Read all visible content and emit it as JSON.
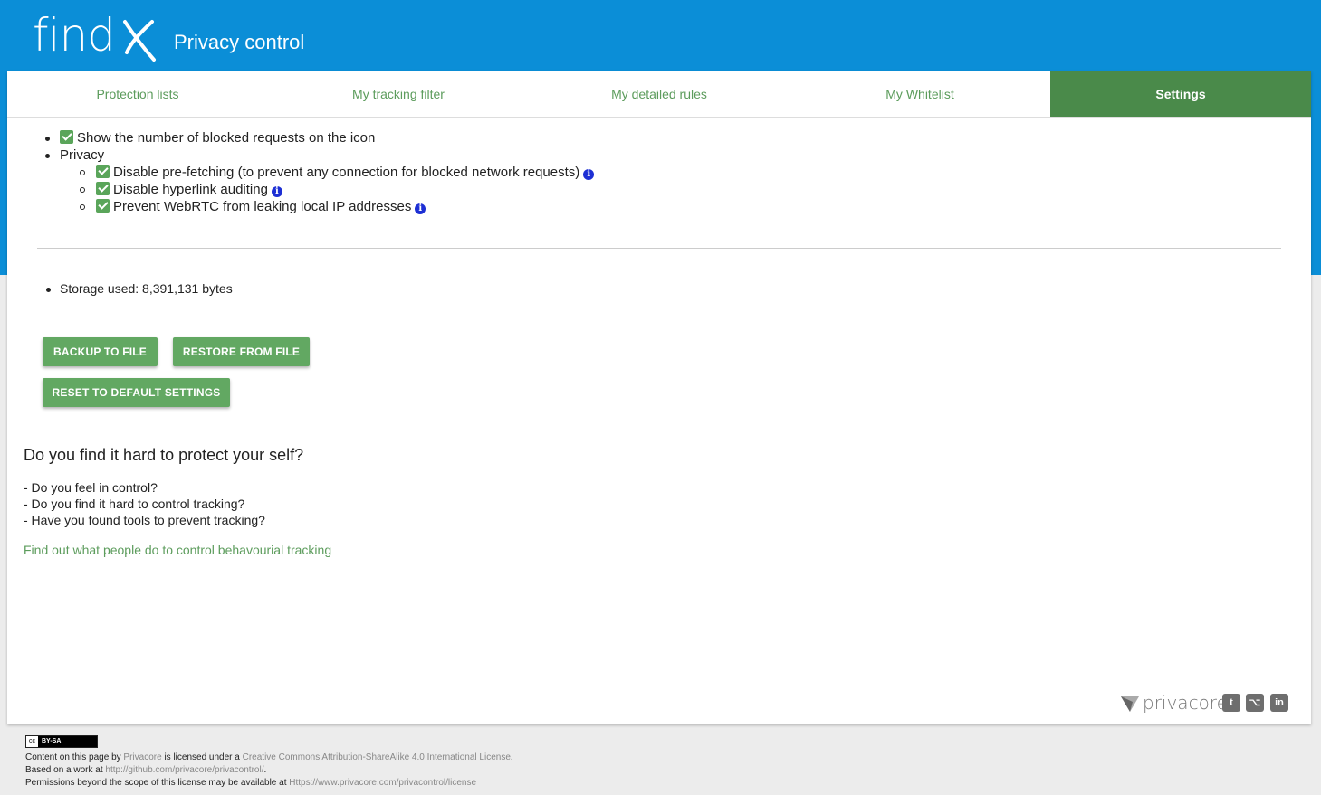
{
  "header": {
    "logo_text": "find",
    "app_title": "Privacy control"
  },
  "tabs": [
    {
      "label": "Protection lists"
    },
    {
      "label": "My tracking filter"
    },
    {
      "label": "My detailed rules"
    },
    {
      "label": "My Whitelist"
    },
    {
      "label": "Settings",
      "active": true
    }
  ],
  "settings": {
    "show_blocked": "Show the number of blocked requests on the icon",
    "privacy_label": "Privacy",
    "privacy_items": [
      "Disable pre-fetching (to prevent any connection for blocked network requests)",
      "Disable hyperlink auditing",
      "Prevent WebRTC from leaking local IP addresses"
    ],
    "storage_used": "Storage used: 8,391,131 bytes"
  },
  "buttons": {
    "backup": "BACKUP TO FILE",
    "restore": "RESTORE FROM FILE",
    "reset": "RESET TO DEFAULT SETTINGS"
  },
  "promo": {
    "heading": "Do you find it hard to protect your self?",
    "lines": [
      "- Do you feel in control?",
      "- Do you find it hard to control tracking?",
      "- Have you found tools to prevent tracking?"
    ],
    "link": "Find out what people do to control behavourial tracking"
  },
  "brand": {
    "name": "privacore"
  },
  "footer": {
    "badge": "BY-SA",
    "line1_a": "Content on this page by ",
    "line1_link1": "Privacore",
    "line1_b": " is licensed under a ",
    "line1_link2": "Creative Commons Attribution-ShareAlike 4.0 International License",
    "line2_a": "Based on a work at ",
    "line2_link": "http://github.com/privacore/privacontrol/",
    "line3_a": "Permissions beyond the scope of this license may be available at ",
    "line3_link": "Https://www.privacore.com/privacontrol/license"
  },
  "colors": {
    "header_blue": "#0b8ed7",
    "accent_green": "#4a8a4a",
    "button_green": "#62a862",
    "info_blue": "#1d2fd4"
  }
}
